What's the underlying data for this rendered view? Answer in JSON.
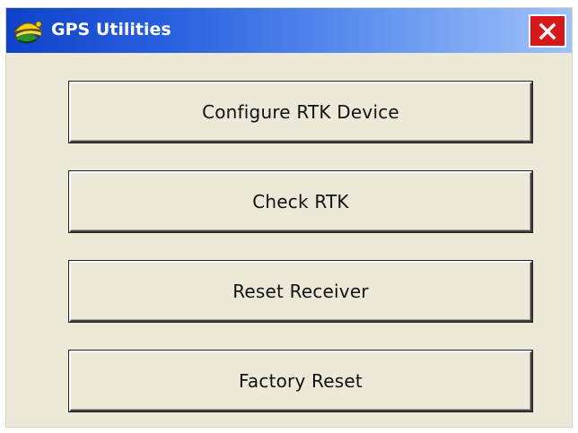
{
  "window": {
    "title": "GPS Utilities",
    "app_icon": "gps-helmet-icon",
    "close_icon": "close-icon",
    "close_color": "#d7161a",
    "titlebar_color": "#2a62e0"
  },
  "buttons": [
    {
      "label": "Configure RTK Device"
    },
    {
      "label": "Check RTK"
    },
    {
      "label": "Reset Receiver"
    },
    {
      "label": "Factory Reset"
    }
  ]
}
